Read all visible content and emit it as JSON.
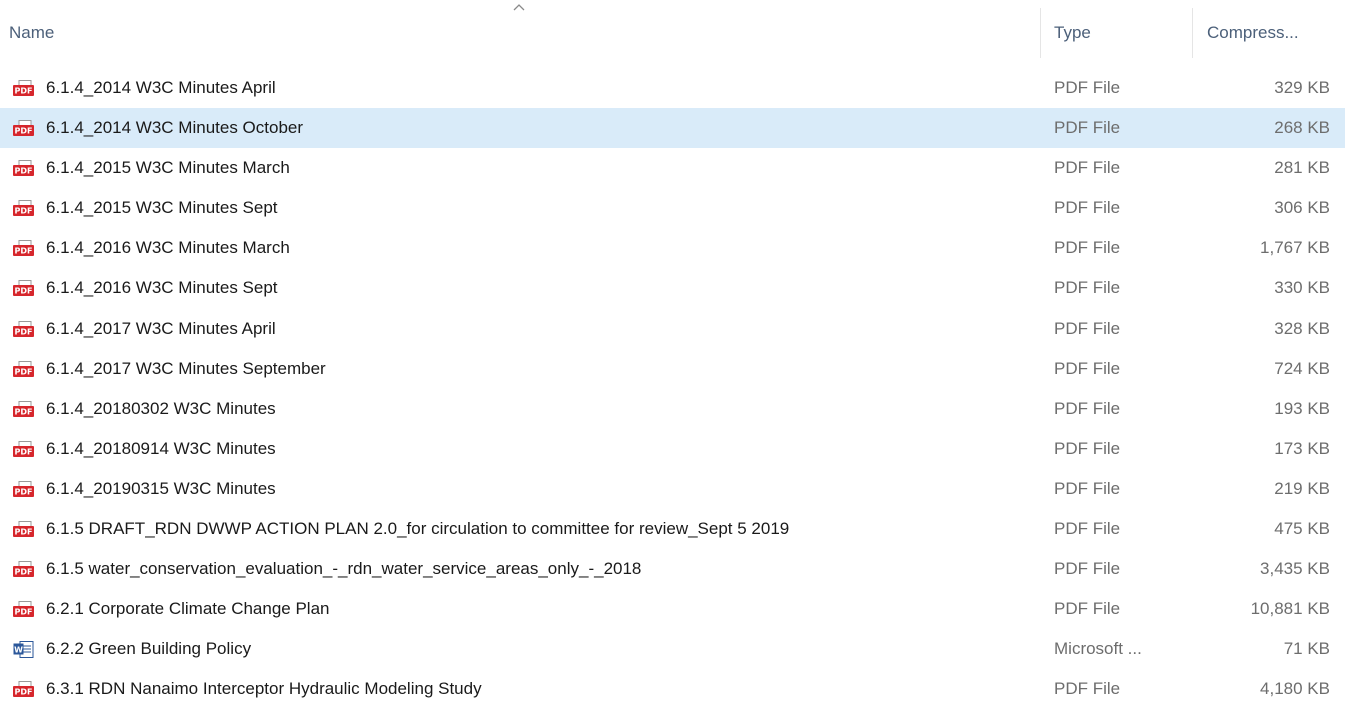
{
  "columns": {
    "name": "Name",
    "type": "Type",
    "compressed": "Compress..."
  },
  "sort": {
    "column": "name",
    "direction": "ascending"
  },
  "selected_index": 1,
  "colors": {
    "selection": "#d9ebf9",
    "pdf_icon": "#d6262c",
    "word_icon": "#2b579a"
  },
  "files": [
    {
      "icon": "pdf-icon",
      "name": "6.1.4_2014 W3C Minutes April",
      "type": "PDF File",
      "size": "329 KB"
    },
    {
      "icon": "pdf-icon",
      "name": "6.1.4_2014 W3C Minutes October",
      "type": "PDF File",
      "size": "268 KB"
    },
    {
      "icon": "pdf-icon",
      "name": "6.1.4_2015 W3C Minutes March",
      "type": "PDF File",
      "size": "281 KB"
    },
    {
      "icon": "pdf-icon",
      "name": "6.1.4_2015 W3C Minutes Sept",
      "type": "PDF File",
      "size": "306 KB"
    },
    {
      "icon": "pdf-icon",
      "name": "6.1.4_2016 W3C Minutes March",
      "type": "PDF File",
      "size": "1,767 KB"
    },
    {
      "icon": "pdf-icon",
      "name": "6.1.4_2016 W3C Minutes Sept",
      "type": "PDF File",
      "size": "330 KB"
    },
    {
      "icon": "pdf-icon",
      "name": "6.1.4_2017 W3C Minutes April",
      "type": "PDF File",
      "size": "328 KB"
    },
    {
      "icon": "pdf-icon",
      "name": "6.1.4_2017 W3C Minutes September",
      "type": "PDF File",
      "size": "724 KB"
    },
    {
      "icon": "pdf-icon",
      "name": "6.1.4_20180302 W3C Minutes",
      "type": "PDF File",
      "size": "193 KB"
    },
    {
      "icon": "pdf-icon",
      "name": "6.1.4_20180914 W3C Minutes",
      "type": "PDF File",
      "size": "173 KB"
    },
    {
      "icon": "pdf-icon",
      "name": "6.1.4_20190315 W3C Minutes",
      "type": "PDF File",
      "size": "219 KB"
    },
    {
      "icon": "pdf-icon",
      "name": "6.1.5 DRAFT_RDN DWWP ACTION PLAN 2.0_for circulation to committee for review_Sept 5 2019",
      "type": "PDF File",
      "size": "475 KB"
    },
    {
      "icon": "pdf-icon",
      "name": "6.1.5 water_conservation_evaluation_-_rdn_water_service_areas_only_-_2018",
      "type": "PDF File",
      "size": "3,435 KB"
    },
    {
      "icon": "pdf-icon",
      "name": "6.2.1 Corporate Climate Change Plan",
      "type": "PDF File",
      "size": "10,881 KB"
    },
    {
      "icon": "word-icon",
      "name": "6.2.2 Green Building Policy",
      "type": "Microsoft ...",
      "size": "71 KB"
    },
    {
      "icon": "pdf-icon",
      "name": "6.3.1 RDN Nanaimo Interceptor Hydraulic Modeling Study",
      "type": "PDF File",
      "size": "4,180 KB"
    }
  ]
}
